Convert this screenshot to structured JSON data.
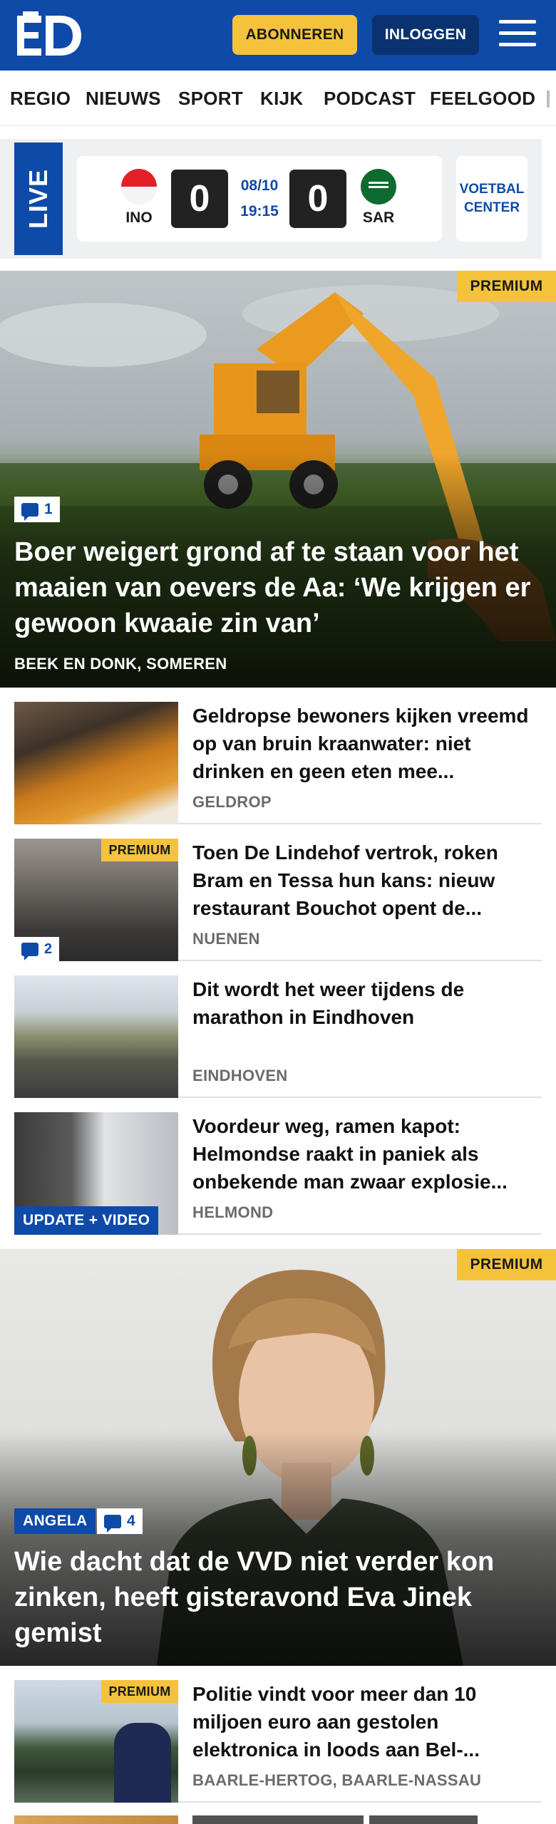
{
  "header": {
    "logo_text": "ED",
    "subscribe_label": "ABONNEREN",
    "login_label": "INLOGGEN",
    "menu_icon": "hamburger-menu-icon",
    "brand_color": "#0e4aa8",
    "accent_color": "#f5c33b"
  },
  "nav": {
    "items": [
      "REGIO",
      "NIEUWS",
      "SPORT",
      "KIJK",
      "PODCAST",
      "FEELGOOD"
    ]
  },
  "live": {
    "label": "LIVE",
    "home_team": "INO",
    "away_team": "SAR",
    "home_score": "0",
    "away_score": "0",
    "date": "08/10",
    "time": "19:15",
    "voetbal_center_line1": "VOETBAL",
    "voetbal_center_line2": "CENTER"
  },
  "hero_1": {
    "badge": "PREMIUM",
    "comments": "1",
    "title": "Boer weigert grond af te staan voor het maaien van oevers de Aa: ‘We krijgen er gewoon kwaaie zin van’",
    "location": "BEEK EN DONK, SOMEREN"
  },
  "articles_1": [
    {
      "title": "Geldropse bewoners kijken vreemd op van bruin kraanwater: niet drinken en geen eten mee...",
      "location": "GELDROP"
    },
    {
      "title": "Toen De Lindehof vertrok, roken Bram en Tessa hun kans: nieuw restaurant Bouchot opent de...",
      "location": "NUENEN",
      "badge": "PREMIUM",
      "comments": "2"
    },
    {
      "title": "Dit wordt het weer tijdens de marathon in Eindhoven",
      "location": "EINDHOVEN"
    },
    {
      "title": "Voordeur weg, ramen kapot: Helmondse raakt in paniek als onbekende man zwaar explosie...",
      "location": "HELMOND",
      "tag": "UPDATE + VIDEO"
    }
  ],
  "hero_2": {
    "badge": "PREMIUM",
    "author_tag": "ANGELA",
    "comments": "4",
    "title": "Wie dacht dat de VVD niet verder kon zinken, heeft gisteravond Eva Jinek gemist"
  },
  "articles_2": [
    {
      "title": "Politie vindt voor meer dan 10 miljoen euro aan gestolen elektronica in loods aan Bel-...",
      "location": "BAARLE-HERTOG, BAARLE-NASSAU",
      "badge": "PREMIUM"
    }
  ]
}
